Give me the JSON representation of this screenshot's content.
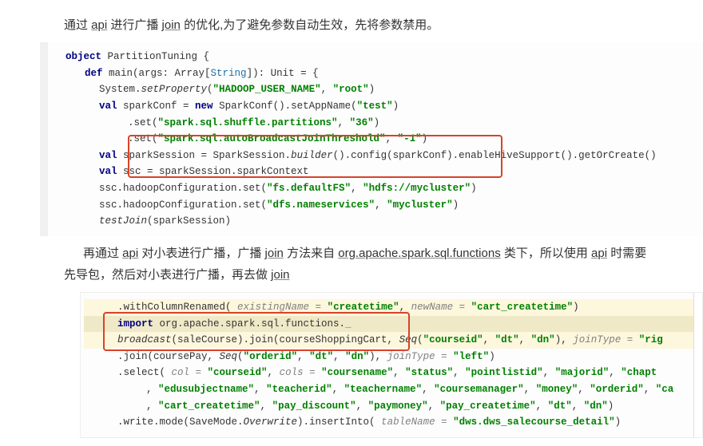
{
  "text": {
    "para1_pre": "通过 ",
    "api": "api",
    "para1_mid": " 进行广播 ",
    "join": "join",
    "para1_post": " 的优化,为了避免参数自动生效，先将参数禁用。",
    "para2_pre": "再通过 ",
    "para2_mid1": " 对小表进行广播，广播 ",
    "para2_mid2": " 方法来自 ",
    "functions_pkg": "org.apache.spark.sql.functions",
    "para2_mid3": " 类下，所以使用 ",
    "para2_post": " 时需要先导包，然后对小表进行广播，再去做 "
  },
  "code1": {
    "l1_kw": "object",
    "l1_name": " PartitionTuning {",
    "l2_kw": "def",
    "l2_main": " main(args: Array[",
    "l2_type": "String",
    "l2_tail": "]): Unit = {",
    "l3_pre": "System.",
    "l3_meth": "setProperty",
    "l3_open": "(",
    "l3_s1": "\"HADOOP_USER_NAME\"",
    "l3_comma": ", ",
    "l3_s2": "\"root\"",
    "l3_close": ")",
    "l4_kw": "val",
    "l4_name": " sparkConf = ",
    "l4_new": "new",
    "l4_tail": " SparkConf().setAppName(",
    "l4_s": "\"test\"",
    "l4_end": ")",
    "l5_pre": ".set(",
    "l5_s1": "\"spark.sql.shuffle.partitions\"",
    "l5_comma": ", ",
    "l5_s2": "\"36\"",
    "l5_end": ")",
    "l6_pre": ".set(",
    "l6_s1": "\"spark.sql.autoBroadcastJoinThreshold\"",
    "l6_comma": ", ",
    "l6_s2": "\"-1\"",
    "l6_end": ")",
    "l7_kw": "val",
    "l7_name": " sparkSession = SparkSession.",
    "l7_builder": "builder",
    "l7_tail": "().config(sparkConf).enableHiveSupport().getOrCreate()",
    "l8_kw": "val",
    "l8_tail": " ssc = sparkSession.sparkContext",
    "l9_pre": "ssc.hadoopConfiguration.set(",
    "l9_s1": "\"fs.defaultFS\"",
    "l9_c": ", ",
    "l9_s2": "\"hdfs://mycluster\"",
    "l9_end": ")",
    "l10_pre": "ssc.hadoopConfiguration.set(",
    "l10_s1": "\"dfs.nameservices\"",
    "l10_c": ", ",
    "l10_s2": "\"mycluster\"",
    "l10_end": ")",
    "l11_meth": "testJoin",
    "l11_arg": "(sparkSession)"
  },
  "code2": {
    "l1_pre": ".withColumnRenamed(",
    "l1_p1": " existingName = ",
    "l1_s1": "\"createtime\"",
    "l1_c": ",  ",
    "l1_p2": "newName = ",
    "l1_s2": "\"cart_createtime\"",
    "l1_end": ")",
    "l2_kw": "import",
    "l2_pkg": " org.apache.spark.sql.functions.",
    "l2_us": "_",
    "l3_bc": "broadcast",
    "l3_arg": "(saleCourse)",
    "l3_join": ".join(courseShoppingCart, ",
    "l3_seq": "Seq",
    "l3_open": "(",
    "l3_s1": "\"courseid\"",
    "l3_c1": ", ",
    "l3_s2": "\"dt\"",
    "l3_c2": ", ",
    "l3_s3": "\"dn\"",
    "l3_close": "),  ",
    "l3_jt": "joinType = ",
    "l3_rig": "\"rig",
    "l4_pre": ".join(coursePay, ",
    "l4_seq": "Seq",
    "l4_open": "(",
    "l4_s1": "\"orderid\"",
    "l4_c1": ", ",
    "l4_s2": "\"dt\"",
    "l4_c2": ", ",
    "l4_s3": "\"dn\"",
    "l4_close": "),  ",
    "l4_jt": "joinType = ",
    "l4_left": "\"left\"",
    "l4_end": ")",
    "l5_pre": ".select(",
    "l5_pcol": " col = ",
    "l5_s1": "\"courseid\"",
    "l5_c1": ",  ",
    "l5_pcols": "cols = ",
    "l5_s2": "\"coursename\"",
    "l5_c2": ", ",
    "l5_s3": "\"status\"",
    "l5_c3": ", ",
    "l5_s4": "\"pointlistid\"",
    "l5_c4": ", ",
    "l5_s5": "\"majorid\"",
    "l5_c5": ", ",
    "l5_s6": "\"chapt",
    "l6_c0": ", ",
    "l6_s1": "\"edusubjectname\"",
    "l6_c1": ", ",
    "l6_s2": "\"teacherid\"",
    "l6_c2": ", ",
    "l6_s3": "\"teachername\"",
    "l6_c3": ", ",
    "l6_s4": "\"coursemanager\"",
    "l6_c4": ", ",
    "l6_s5": "\"money\"",
    "l6_c5": ", ",
    "l6_s6": "\"orderid\"",
    "l6_c6": ", ",
    "l6_s7": "\"ca",
    "l7_c0": ", ",
    "l7_s1": "\"cart_createtime\"",
    "l7_c1": ", ",
    "l7_s2": "\"pay_discount\"",
    "l7_c2": ", ",
    "l7_s3": "\"paymoney\"",
    "l7_c3": ", ",
    "l7_s4": "\"pay_createtime\"",
    "l7_c4": ", ",
    "l7_s5": "\"dt\"",
    "l7_c5": ", ",
    "l7_s6": "\"dn\"",
    "l7_end": ")",
    "l8_pre": ".write.mode(SaveMode.",
    "l8_ow": "Overwrite",
    "l8_mid": ").insertInto(",
    "l8_pt": " tableName = ",
    "l8_s": "\"dws.dws_salecourse_detail\"",
    "l8_end": ")"
  }
}
